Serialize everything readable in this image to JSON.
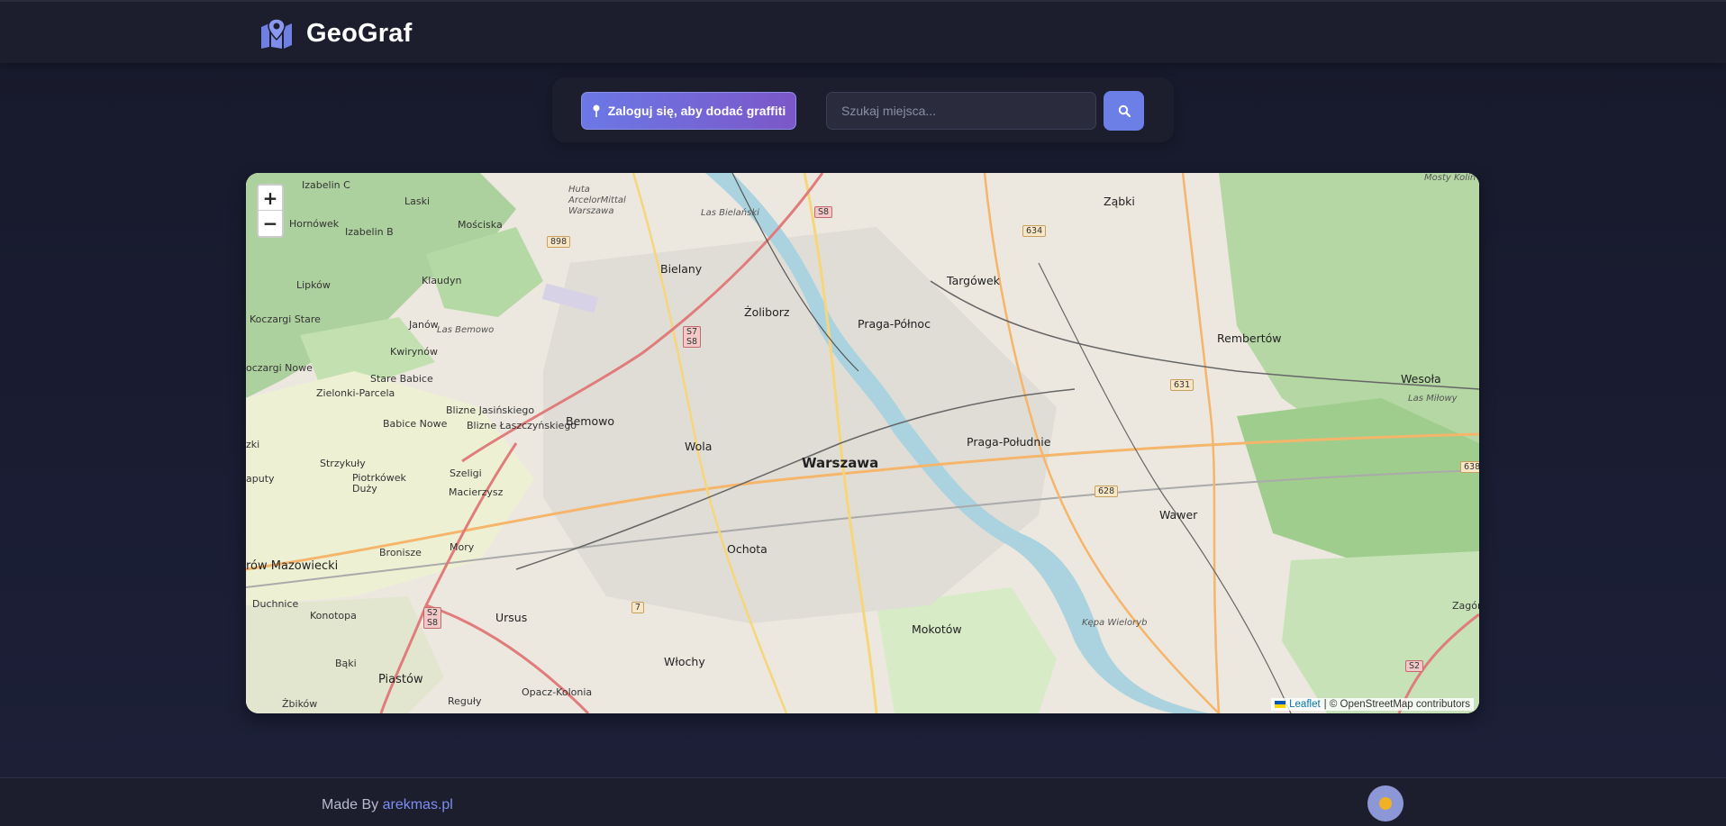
{
  "header": {
    "app_name": "GeoGraf",
    "logo_icon": "map-marker-icon"
  },
  "toolbar": {
    "login_label": "Zaloguj się, aby dodać graffiti",
    "search_placeholder": "Szukaj miejsca...",
    "search_icon": "search-icon"
  },
  "map": {
    "zoom_in": "+",
    "zoom_out": "−",
    "attribution_link": "Leaflet",
    "attribution_text": "| © OpenStreetMap contributors",
    "places": {
      "warszawa": "Warszawa",
      "bielany": "Bielany",
      "zoliborz": "Żoliborz",
      "praga_polnoc": "Praga-Północ",
      "praga_poludnie": "Praga-Południe",
      "targowek": "Targówek",
      "zabki": "Ząbki",
      "rembertow": "Rembertów",
      "wesola": "Wesoła",
      "wawer": "Wawer",
      "wola": "Wola",
      "bemowo": "Bemowo",
      "ochota": "Ochota",
      "mokotow": "Mokotów",
      "wlochy": "Włochy",
      "ursus": "Ursus",
      "piastow": "Piastów",
      "ozarow": "rów Mazowiecki",
      "izabelin_c": "Izabelin C",
      "izabelin_b": "Izabelin B",
      "laski": "Laski",
      "hornowek": "Hornówek",
      "mosciska": "Mościska",
      "lipkow": "Lipków",
      "koczargi_stare": "Koczargi Stare",
      "koczargi_nowe": "oczargi Nowe",
      "janow": "Janów",
      "kwirynow": "Kwirynów",
      "klaudyn": "Klaudyn",
      "stare_babice": "Stare Babice",
      "zielonki": "Zielonki-Parcela",
      "babice_nowe": "Babice Nowe",
      "blizne_jas": "Blizne Jasińskiego",
      "blizne_lasz": "Blizne Łaszczyńskiego",
      "strzykuly": "Strzykuły",
      "szeligi": "Szeligi",
      "piotrkowek": "Piotrkówek Duży",
      "macierzysz": "Macierzysz",
      "bronisze": "Bronisze",
      "mory": "Mory",
      "duchnice": "Duchnice",
      "konotopa": "Konotopa",
      "bakI": "Bąki",
      "zbikow": "Żbików",
      "reguly": "Reguły",
      "opacz": "Opacz-Kolonia",
      "kepa": "Kępa Wieloryb",
      "huta": "Huta ArcelorMittal Warszawa",
      "las_bielanski": "Las Bielański",
      "las_bemowo": "Las Bemowo",
      "mosty": "Mosty Kolin",
      "las_milowy": "Las Miłowy",
      "zagor": "Zagór",
      "zki": "zki",
      "aputy": "aputy"
    },
    "shields": {
      "s8": "S8",
      "s7s8": "S7 S8",
      "r898": "898",
      "r634": "634",
      "r631": "631",
      "r628": "628",
      "r638": "638",
      "r7": "7",
      "s2s8": "S2 S8",
      "s2": "S2"
    }
  },
  "footer": {
    "made_by": "Made By",
    "author": "arekmas.pl",
    "theme_icon": "sun-icon"
  }
}
